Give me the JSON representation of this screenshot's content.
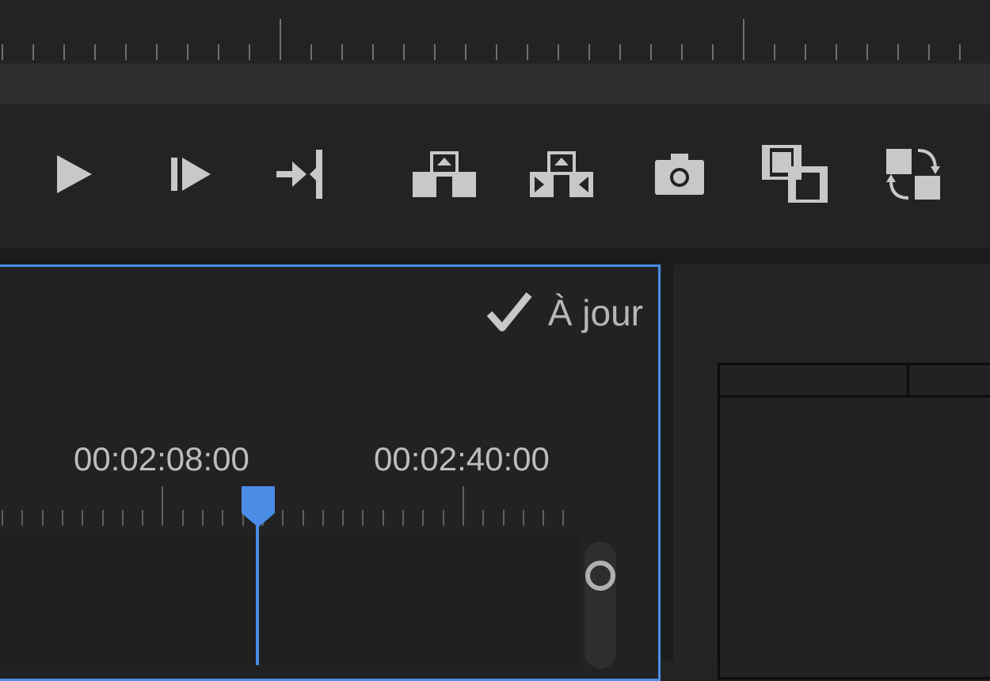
{
  "program_monitor": {
    "ruler": {
      "major_ticks": 2,
      "minor_ticks": 30
    }
  },
  "toolbar": {
    "buttons": [
      {
        "name": "play-button",
        "icon": "play-icon"
      },
      {
        "name": "step-forward-button",
        "icon": "step-forward-icon"
      },
      {
        "name": "go-to-out-button",
        "icon": "go-to-out-point-icon"
      },
      {
        "name": "lift-button",
        "icon": "lift-icon"
      },
      {
        "name": "extract-button",
        "icon": "extract-icon"
      },
      {
        "name": "export-frame-button",
        "icon": "camera-icon"
      },
      {
        "name": "comparison-view-button",
        "icon": "comparison-view-icon"
      },
      {
        "name": "toggle-proxies-button",
        "icon": "toggle-proxies-icon"
      }
    ],
    "icon_color": "#c8c8c8"
  },
  "panel": {
    "status": {
      "icon": "checkmark-icon",
      "label": "À jour"
    },
    "timecodes": [
      "00:02:08:00",
      "00:02:40:00"
    ],
    "accent_color": "#4a8ce6"
  }
}
